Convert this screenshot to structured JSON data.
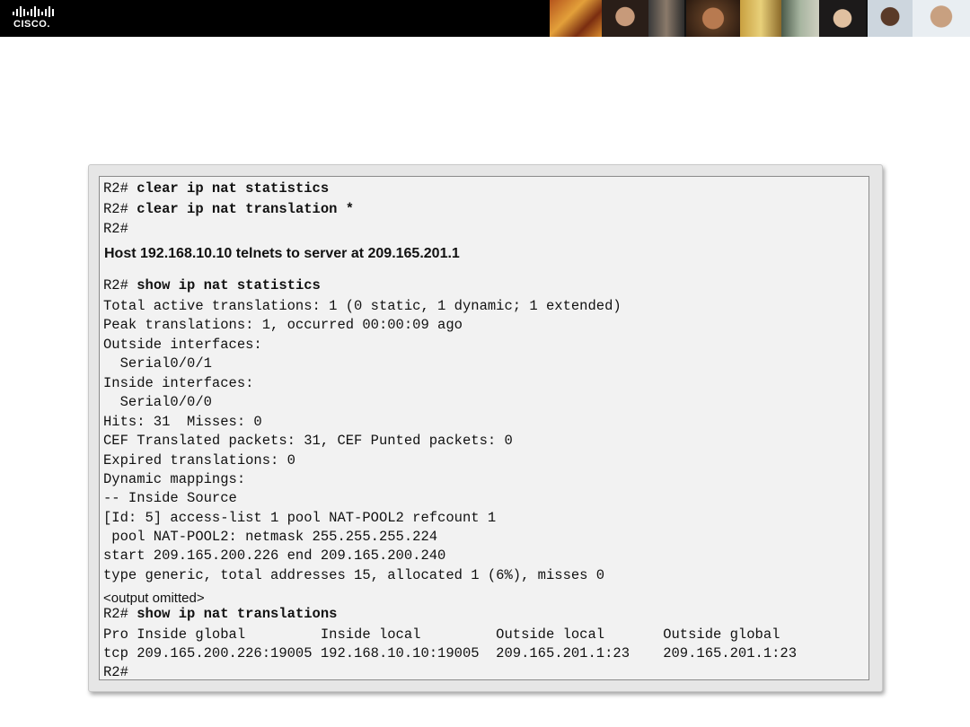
{
  "header": {
    "logo_text": "CISCO."
  },
  "terminal": {
    "prompt": "R2#",
    "cmd_clear_stats": "clear ip nat statistics",
    "cmd_clear_trans": "clear ip nat translation *",
    "note": "Host 192.168.10.10 telnets to server at 209.165.201.1",
    "cmd_show_stats": "show ip nat statistics",
    "stats_lines": [
      "Total active translations: 1 (0 static, 1 dynamic; 1 extended)",
      "Peak translations: 1, occurred 00:00:09 ago",
      "Outside interfaces:",
      "  Serial0/0/1",
      "Inside interfaces:",
      "  Serial0/0/0",
      "Hits: 31  Misses: 0",
      "CEF Translated packets: 31, CEF Punted packets: 0",
      "Expired translations: 0",
      "Dynamic mappings:",
      "-- Inside Source",
      "[Id: 5] access-list 1 pool NAT-POOL2 refcount 1",
      " pool NAT-POOL2: netmask 255.255.255.224",
      "start 209.165.200.226 end 209.165.200.240",
      "type generic, total addresses 15, allocated 1 (6%), misses 0"
    ],
    "omitted": "<output omitted>",
    "cmd_show_trans": "show ip nat translations",
    "table_header": "Pro Inside global         Inside local         Outside local       Outside global",
    "table_row": "tcp 209.165.200.226:19005 192.168.10.10:19005  209.165.201.1:23    209.165.201.1:23"
  }
}
